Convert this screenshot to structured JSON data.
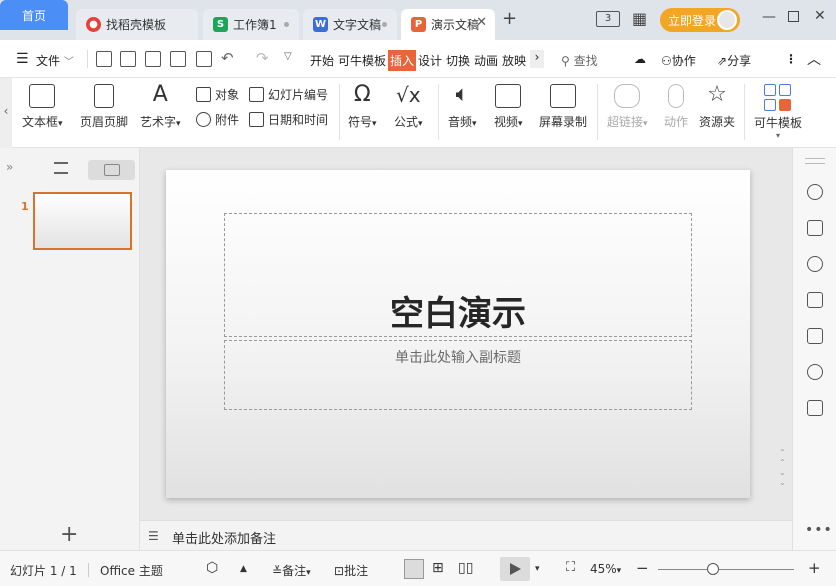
{
  "tabs": {
    "home": "首页",
    "items": [
      {
        "label": "找稻壳模板",
        "icon": "docer-icon",
        "color": "#e8403a"
      },
      {
        "label": "工作簿1",
        "icon": "spreadsheet-icon",
        "color": "#1fa45a"
      },
      {
        "label": "文字文稿",
        "icon": "writer-icon",
        "color": "#3b6fd7"
      },
      {
        "label": "演示文稿",
        "icon": "presentation-icon",
        "color": "#e8643a"
      }
    ],
    "new_tab": "+",
    "login": "立即登录",
    "page_badge": "3"
  },
  "menu": {
    "file": "文件",
    "items": [
      "开始",
      "可牛模板",
      "插入",
      "设计",
      "切换",
      "动画",
      "放映"
    ],
    "active": "插入",
    "active_color": "#e8643a",
    "search": "查找",
    "collab": "协作",
    "share": "分享"
  },
  "ribbon": {
    "textbox": "文本框",
    "header_footer": "页眉页脚",
    "wordart": "艺术字",
    "object": "对象",
    "attachment": "附件",
    "slide_number": "幻灯片编号",
    "date_time": "日期和时间",
    "symbol": "符号",
    "formula": "公式",
    "audio": "音频",
    "video": "视频",
    "screen_record": "屏幕录制",
    "hyperlink": "超链接",
    "action": "动作",
    "resources": "资源夹",
    "kn_template": "可牛模板"
  },
  "panel": {
    "slide_index": "1"
  },
  "slide": {
    "title": "空白演示",
    "subtitle": "单击此处输入副标题"
  },
  "notes": {
    "placeholder": "单击此处添加备注"
  },
  "status": {
    "slide_info": "幻灯片 1 / 1",
    "theme": "Office 主题",
    "notes": "备注",
    "comments": "批注",
    "zoom": "45%",
    "zoom_level": 0.45
  }
}
